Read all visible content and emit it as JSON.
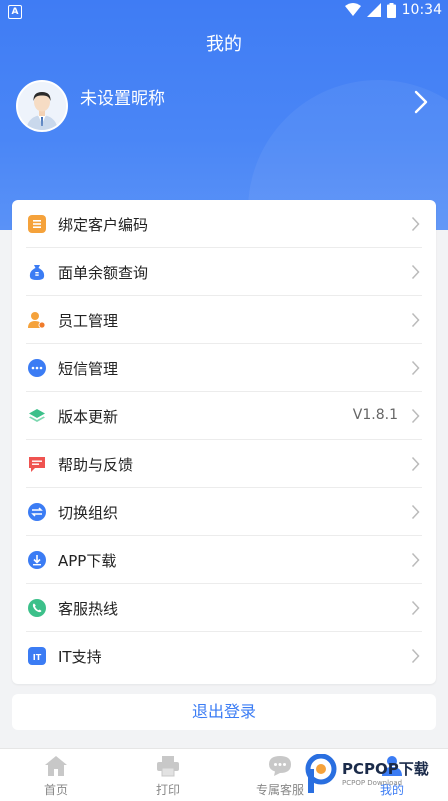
{
  "status_bar": {
    "time": "10:34"
  },
  "header": {
    "title": "我的",
    "nickname": "未设置昵称"
  },
  "menu": [
    {
      "label": "绑定客户编码",
      "icon": "list-icon",
      "color": "#f5a23b",
      "value": ""
    },
    {
      "label": "面单余额查询",
      "icon": "money-bag-icon",
      "color": "#3b7cf4",
      "value": ""
    },
    {
      "label": "员工管理",
      "icon": "user-manage-icon",
      "color": "#f5a23b",
      "value": ""
    },
    {
      "label": "短信管理",
      "icon": "message-icon",
      "color": "#3b7cf4",
      "value": ""
    },
    {
      "label": "版本更新",
      "icon": "layers-icon",
      "color": "#3cc08a",
      "value": "V1.8.1"
    },
    {
      "label": "帮助与反馈",
      "icon": "feedback-icon",
      "color": "#ef5350",
      "value": ""
    },
    {
      "label": "切换组织",
      "icon": "switch-icon",
      "color": "#3b7cf4",
      "value": ""
    },
    {
      "label": "APP下载",
      "icon": "download-icon",
      "color": "#3b7cf4",
      "value": ""
    },
    {
      "label": "客服热线",
      "icon": "phone-icon",
      "color": "#3cc08a",
      "value": ""
    },
    {
      "label": "IT支持",
      "icon": "it-support-icon",
      "color": "#3b7cf4",
      "value": ""
    }
  ],
  "logout_label": "退出登录",
  "tabs": [
    {
      "label": "首页",
      "icon": "home-icon",
      "active": false
    },
    {
      "label": "打印",
      "icon": "printer-icon",
      "active": false
    },
    {
      "label": "专属客服",
      "icon": "chat-icon",
      "active": false
    },
    {
      "label": "我的",
      "icon": "profile-icon",
      "active": true
    }
  ],
  "watermark": {
    "brand": "PCPOP下载",
    "sub": "PCPOP Download"
  },
  "colors": {
    "primary": "#3b7cf4",
    "header": "#4a86f6"
  }
}
